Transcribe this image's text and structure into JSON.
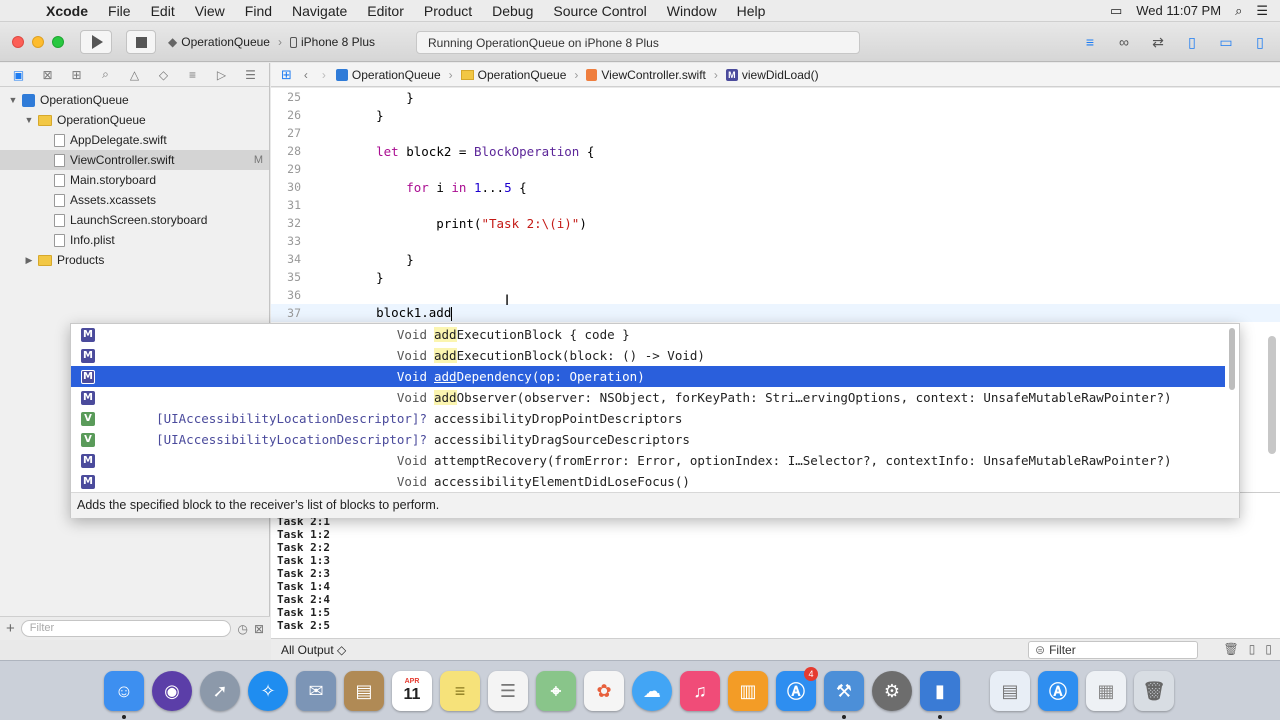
{
  "menubar": {
    "app": "Xcode",
    "items": [
      "File",
      "Edit",
      "View",
      "Find",
      "Navigate",
      "Editor",
      "Product",
      "Debug",
      "Source Control",
      "Window",
      "Help"
    ],
    "clock": "Wed 11:07 PM"
  },
  "toolbar": {
    "scheme": "OperationQueue",
    "device": "iPhone 8 Plus",
    "status": "Running OperationQueue on iPhone 8 Plus"
  },
  "navigator": {
    "tree": [
      {
        "label": "OperationQueue",
        "kind": "project",
        "disclosure": "▼",
        "level": 0
      },
      {
        "label": "OperationQueue",
        "kind": "folder",
        "disclosure": "▼",
        "level": 1
      },
      {
        "label": "AppDelegate.swift",
        "kind": "file",
        "level": 2
      },
      {
        "label": "ViewController.swift",
        "kind": "file",
        "level": 2,
        "selected": true,
        "status": "M"
      },
      {
        "label": "Main.storyboard",
        "kind": "file",
        "level": 2
      },
      {
        "label": "Assets.xcassets",
        "kind": "file",
        "level": 2
      },
      {
        "label": "LaunchScreen.storyboard",
        "kind": "file",
        "level": 2
      },
      {
        "label": "Info.plist",
        "kind": "file",
        "level": 2
      },
      {
        "label": "Products",
        "kind": "folder",
        "disclosure": "▶",
        "level": 1
      }
    ],
    "filter_placeholder": "Filter"
  },
  "jumpbar": {
    "crumbs": [
      "OperationQueue",
      "OperationQueue",
      "ViewController.swift",
      "viewDidLoad()"
    ]
  },
  "editor": {
    "lines": [
      {
        "n": "25",
        "text": "        }"
      },
      {
        "n": "26",
        "text": "    }"
      },
      {
        "n": "27",
        "text": ""
      },
      {
        "n": "28",
        "text": "    let block2 = BlockOperation {"
      },
      {
        "n": "29",
        "text": ""
      },
      {
        "n": "30",
        "text": "        for i in 1...5 {"
      },
      {
        "n": "31",
        "text": ""
      },
      {
        "n": "32",
        "text": "            print(\"Task 2:\\(i)\")"
      },
      {
        "n": "33",
        "text": ""
      },
      {
        "n": "34",
        "text": "        }"
      },
      {
        "n": "35",
        "text": "    }"
      },
      {
        "n": "36",
        "text": ""
      },
      {
        "n": "37",
        "text": "    block1.add"
      }
    ]
  },
  "autocomplete": {
    "items": [
      {
        "badge": "M",
        "type": "Void",
        "match": "add",
        "rest": "ExecutionBlock { code }"
      },
      {
        "badge": "M",
        "type": "Void",
        "match": "add",
        "rest": "ExecutionBlock(block: () -> Void)"
      },
      {
        "badge": "M",
        "type": "Void",
        "match": "add",
        "rest": "Dependency(op: Operation)",
        "selected": true
      },
      {
        "badge": "M",
        "type": "Void",
        "match": "add",
        "rest": "Observer(observer: NSObject, forKeyPath: Stri…ervingOptions, context: UnsafeMutableRawPointer?)"
      },
      {
        "badge": "V",
        "type": "[UIAccessibilityLocationDescriptor]?",
        "match": "",
        "rest": "accessibilityDropPointDescriptors"
      },
      {
        "badge": "V",
        "type": "[UIAccessibilityLocationDescriptor]?",
        "match": "",
        "rest": "accessibilityDragSourceDescriptors"
      },
      {
        "badge": "M",
        "type": "Void",
        "match": "",
        "rest": "attemptRecovery(fromError: Error, optionIndex: I…Selector?, contextInfo: UnsafeMutableRawPointer?)"
      },
      {
        "badge": "M",
        "type": "Void",
        "match": "",
        "rest": "accessibilityElementDidLoseFocus()"
      }
    ],
    "description": "Adds the specified block to the receiver’s list of blocks to perform."
  },
  "console": {
    "output": [
      "Task 2:1",
      "Task 1:2",
      "Task 2:2",
      "Task 1:3",
      "Task 2:3",
      "Task 1:4",
      "Task 2:4",
      "Task 1:5",
      "Task 2:5"
    ],
    "output_select": "All Output ◇",
    "filter_placeholder": "Filter"
  },
  "dock": {
    "calendar_month": "APR",
    "calendar_day": "11",
    "appstore_badge": "4"
  }
}
